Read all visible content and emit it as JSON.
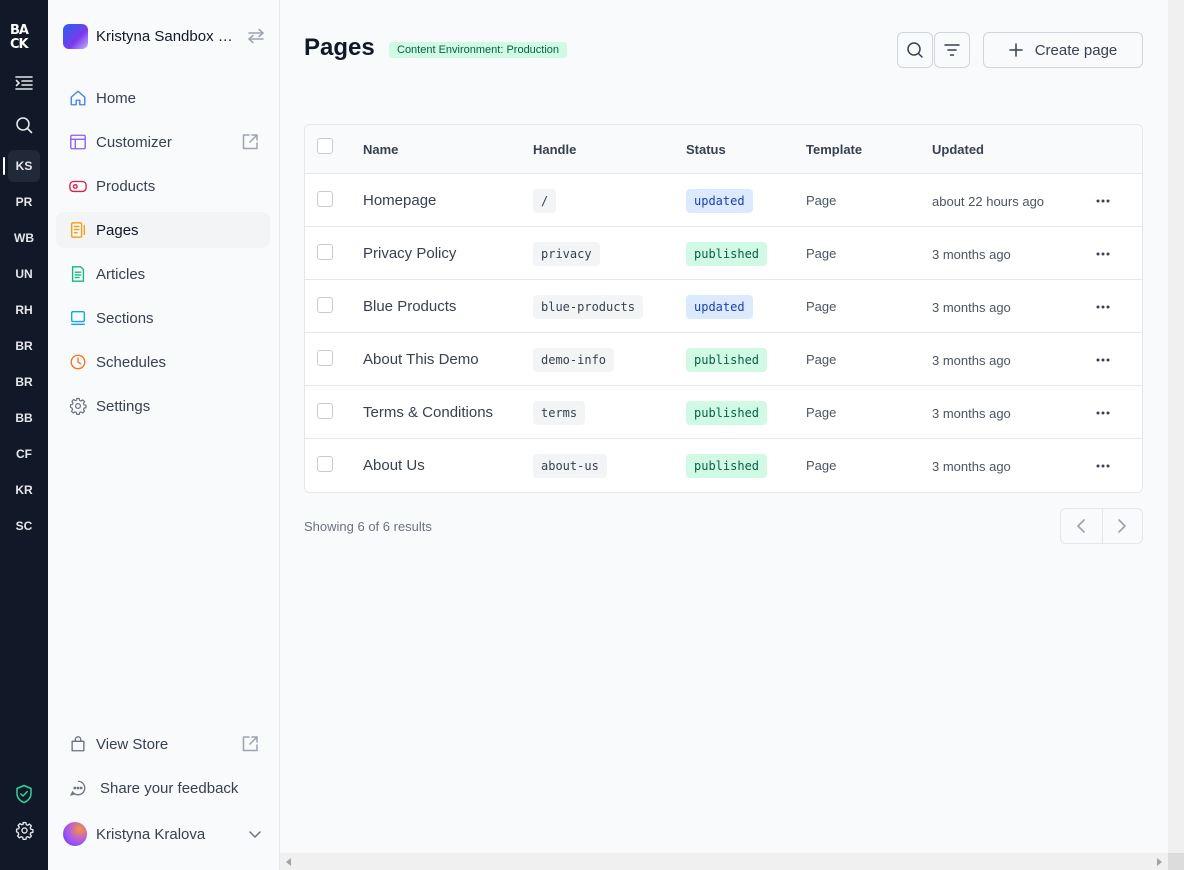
{
  "rail": {
    "logo": "BACK",
    "icons": [
      "menu-icon",
      "search-icon"
    ],
    "stores": [
      "KS",
      "PR",
      "WB",
      "UN",
      "RH",
      "BR",
      "BR",
      "BB",
      "CF",
      "KR",
      "SC"
    ],
    "bottom_icons": [
      "shield-check-icon",
      "gear-icon"
    ]
  },
  "sidebar": {
    "store_name": "Kristyna Sandbox S...",
    "items": [
      {
        "label": "Home",
        "icon": "home-icon"
      },
      {
        "label": "Customizer",
        "icon": "customizer-icon"
      },
      {
        "label": "Products",
        "icon": "products-icon"
      },
      {
        "label": "Pages",
        "icon": "pages-icon"
      },
      {
        "label": "Articles",
        "icon": "articles-icon"
      },
      {
        "label": "Sections",
        "icon": "sections-icon"
      },
      {
        "label": "Schedules",
        "icon": "clock-icon"
      },
      {
        "label": "Settings",
        "icon": "gear-icon"
      }
    ],
    "view_store": "View Store",
    "feedback": "Share your feedback",
    "user_name": "Kristyna Kralova"
  },
  "main": {
    "title": "Pages",
    "env_badge": "Content Environment: Production",
    "create_label": "Create page",
    "columns": {
      "name": "Name",
      "handle": "Handle",
      "status": "Status",
      "template": "Template",
      "updated": "Updated"
    },
    "rows": [
      {
        "name": "Homepage",
        "handle": "/",
        "status": "updated",
        "template": "Page",
        "updated": "about 22 hours ago"
      },
      {
        "name": "Privacy Policy",
        "handle": "privacy",
        "status": "published",
        "template": "Page",
        "updated": "3 months ago"
      },
      {
        "name": "Blue Products",
        "handle": "blue-products",
        "status": "updated",
        "template": "Page",
        "updated": "3 months ago"
      },
      {
        "name": "About This Demo",
        "handle": "demo-info",
        "status": "published",
        "template": "Page",
        "updated": "3 months ago"
      },
      {
        "name": "Terms & Conditions",
        "handle": "terms",
        "status": "published",
        "template": "Page",
        "updated": "3 months ago"
      },
      {
        "name": "About Us",
        "handle": "about-us",
        "status": "published",
        "template": "Page",
        "updated": "3 months ago"
      }
    ],
    "results_text": "Showing 6 of 6 results"
  },
  "colors": {
    "rail_bg": "#111827",
    "updated_badge": "#dbeafe",
    "published_badge": "#d1fae5"
  }
}
